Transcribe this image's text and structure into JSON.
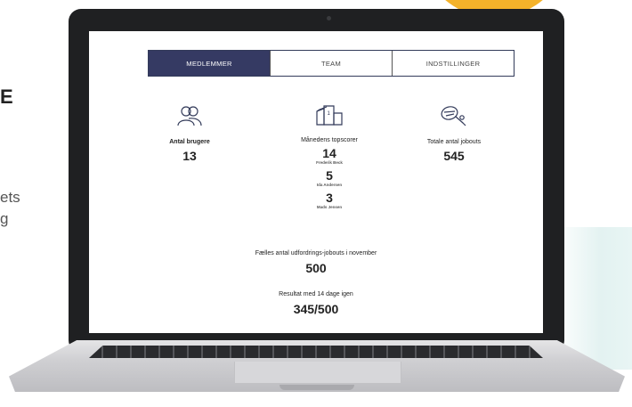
{
  "side": {
    "heading_fragment": "E",
    "line1": "ets",
    "line2": "g"
  },
  "tabs": [
    {
      "label": "MEDLEMMER",
      "active": true
    },
    {
      "label": "TEAM",
      "active": false
    },
    {
      "label": "INDSTILLINGER",
      "active": false
    }
  ],
  "users": {
    "icon": "users-icon",
    "label": "Antal brugere",
    "value": "13"
  },
  "topscorer": {
    "icon": "podium-icon",
    "label": "Månedens topscorer",
    "entries": [
      {
        "value": "14",
        "name": "Frederik Beck"
      },
      {
        "value": "5",
        "name": "Ida Andersen"
      },
      {
        "value": "3",
        "name": "Mads Jensen"
      }
    ]
  },
  "jobouts": {
    "icon": "tennis-icon",
    "label": "Totale antal jobouts",
    "value": "545"
  },
  "challenge": {
    "label": "Fælles antal udfordrings-jobouts i november",
    "value": "500"
  },
  "result": {
    "label": "Resultat med 14 dage igen",
    "value": "345/500"
  },
  "colors": {
    "active_tab": "#353a63",
    "accent": "#f4b22a"
  }
}
